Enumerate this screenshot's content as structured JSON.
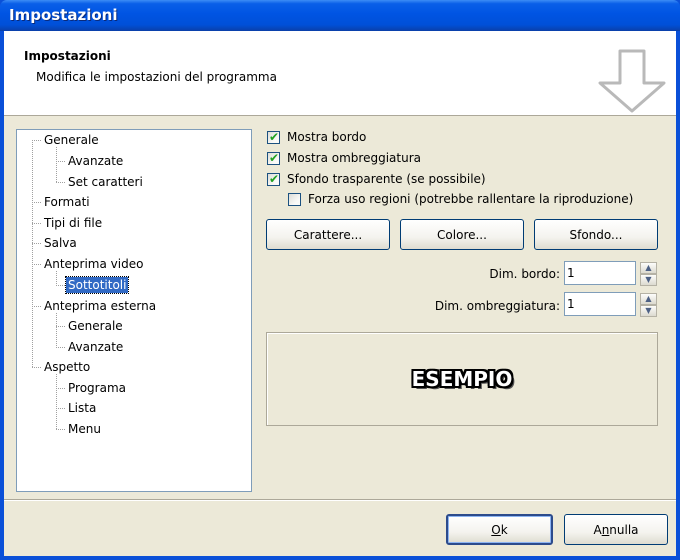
{
  "window": {
    "title": "Impostazioni"
  },
  "banner": {
    "title": "Impostazioni",
    "subtitle": "Modifica le impostazioni del programma",
    "icon": "down-arrow-icon"
  },
  "tree": {
    "items": [
      {
        "label": "Generale",
        "level": 0
      },
      {
        "label": "Avanzate",
        "level": 1
      },
      {
        "label": "Set caratteri",
        "level": 1
      },
      {
        "label": "Formati",
        "level": 0
      },
      {
        "label": "Tipi di file",
        "level": 0
      },
      {
        "label": "Salva",
        "level": 0
      },
      {
        "label": "Anteprima video",
        "level": 0
      },
      {
        "label": "Sottotitoli",
        "level": 1,
        "selected": true
      },
      {
        "label": "Anteprima esterna",
        "level": 0
      },
      {
        "label": "Generale",
        "level": 1
      },
      {
        "label": "Avanzate",
        "level": 1
      },
      {
        "label": "Aspetto",
        "level": 0
      },
      {
        "label": "Programa",
        "level": 1
      },
      {
        "label": "Lista",
        "level": 1
      },
      {
        "label": "Menu",
        "level": 1
      }
    ]
  },
  "options": {
    "show_border": {
      "label": "Mostra bordo",
      "checked": true
    },
    "show_shadow": {
      "label": "Mostra ombreggiatura",
      "checked": true
    },
    "transparent_bg": {
      "label": "Sfondo trasparente (se possibile)",
      "checked": true
    },
    "force_regions": {
      "label": "Forza uso regioni (potrebbe rallentare la riproduzione)",
      "checked": false
    }
  },
  "buttons": {
    "font": "Carattere...",
    "color": "Colore...",
    "background": "Sfondo...",
    "ok": "Ok",
    "ok_accel": "O",
    "ok_rest": "k",
    "cancel": "Annulla",
    "cancel_pre": "A",
    "cancel_accel": "n",
    "cancel_rest": "nulla"
  },
  "spinners": {
    "border_size": {
      "label": "Dim. bordo:",
      "value": "1"
    },
    "shadow_size": {
      "label": "Dim. ombreggiatura:",
      "value": "1"
    }
  },
  "preview": {
    "text": "ESEMPIO"
  },
  "colors": {
    "titlebar": "#0054e3",
    "face": "#ece9d8",
    "selection": "#316ac5",
    "check": "#21a121"
  }
}
